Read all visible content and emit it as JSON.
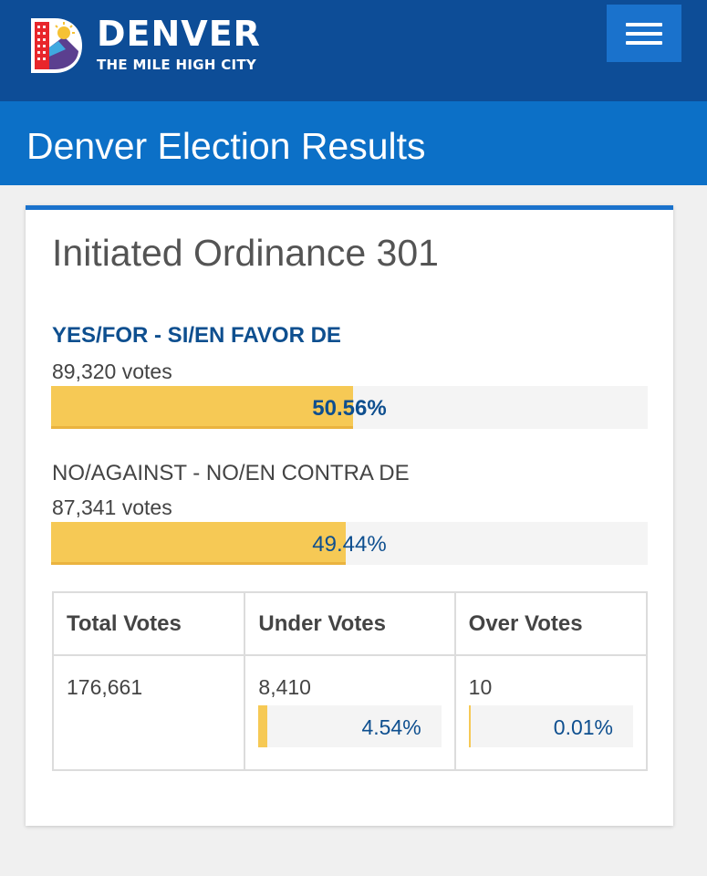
{
  "header": {
    "brand_name": "DENVER",
    "brand_tagline": "THE MILE HIGH CITY",
    "logo_icon": "denver-d-logo",
    "menu_icon": "hamburger-menu-icon",
    "brand_color": "#0d4d97",
    "accent_color": "#1a72cc"
  },
  "page": {
    "title": "Denver Election Results"
  },
  "contest": {
    "title": "Initiated Ordinance 301",
    "choices": [
      {
        "name": "YES/FOR - SI/EN FAVOR DE",
        "votes": "89,320 votes",
        "percent_label": "50.56%",
        "percent": 50.56,
        "leading": true
      },
      {
        "name": "NO/AGAINST - NO/EN CONTRA DE",
        "votes": "87,341 votes",
        "percent_label": "49.44%",
        "percent": 49.44,
        "leading": false
      }
    ],
    "bar_color": "#f6c955",
    "totals": {
      "headers": [
        "Total Votes",
        "Under Votes",
        "Over Votes"
      ],
      "total_votes": "176,661",
      "under_votes": "8,410",
      "under_percent_label": "4.54%",
      "under_percent": 4.54,
      "over_votes": "10",
      "over_percent_label": "0.01%",
      "over_percent": 0.01
    }
  }
}
